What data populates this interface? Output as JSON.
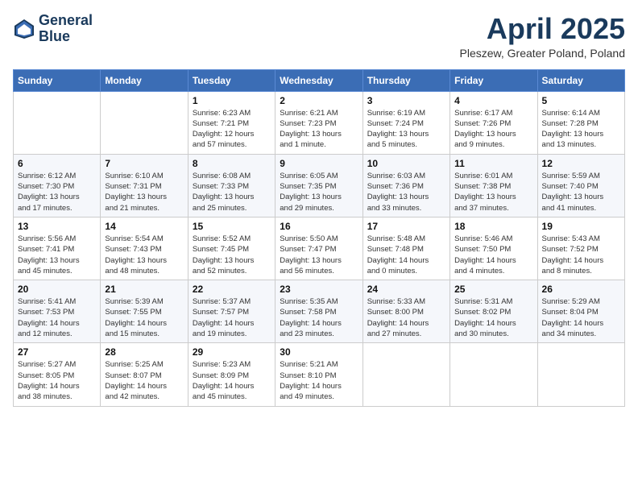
{
  "header": {
    "logo_line1": "General",
    "logo_line2": "Blue",
    "month_title": "April 2025",
    "location": "Pleszew, Greater Poland, Poland"
  },
  "weekdays": [
    "Sunday",
    "Monday",
    "Tuesday",
    "Wednesday",
    "Thursday",
    "Friday",
    "Saturday"
  ],
  "weeks": [
    [
      {
        "day": "",
        "info": ""
      },
      {
        "day": "",
        "info": ""
      },
      {
        "day": "1",
        "info": "Sunrise: 6:23 AM\nSunset: 7:21 PM\nDaylight: 12 hours\nand 57 minutes."
      },
      {
        "day": "2",
        "info": "Sunrise: 6:21 AM\nSunset: 7:23 PM\nDaylight: 13 hours\nand 1 minute."
      },
      {
        "day": "3",
        "info": "Sunrise: 6:19 AM\nSunset: 7:24 PM\nDaylight: 13 hours\nand 5 minutes."
      },
      {
        "day": "4",
        "info": "Sunrise: 6:17 AM\nSunset: 7:26 PM\nDaylight: 13 hours\nand 9 minutes."
      },
      {
        "day": "5",
        "info": "Sunrise: 6:14 AM\nSunset: 7:28 PM\nDaylight: 13 hours\nand 13 minutes."
      }
    ],
    [
      {
        "day": "6",
        "info": "Sunrise: 6:12 AM\nSunset: 7:30 PM\nDaylight: 13 hours\nand 17 minutes."
      },
      {
        "day": "7",
        "info": "Sunrise: 6:10 AM\nSunset: 7:31 PM\nDaylight: 13 hours\nand 21 minutes."
      },
      {
        "day": "8",
        "info": "Sunrise: 6:08 AM\nSunset: 7:33 PM\nDaylight: 13 hours\nand 25 minutes."
      },
      {
        "day": "9",
        "info": "Sunrise: 6:05 AM\nSunset: 7:35 PM\nDaylight: 13 hours\nand 29 minutes."
      },
      {
        "day": "10",
        "info": "Sunrise: 6:03 AM\nSunset: 7:36 PM\nDaylight: 13 hours\nand 33 minutes."
      },
      {
        "day": "11",
        "info": "Sunrise: 6:01 AM\nSunset: 7:38 PM\nDaylight: 13 hours\nand 37 minutes."
      },
      {
        "day": "12",
        "info": "Sunrise: 5:59 AM\nSunset: 7:40 PM\nDaylight: 13 hours\nand 41 minutes."
      }
    ],
    [
      {
        "day": "13",
        "info": "Sunrise: 5:56 AM\nSunset: 7:41 PM\nDaylight: 13 hours\nand 45 minutes."
      },
      {
        "day": "14",
        "info": "Sunrise: 5:54 AM\nSunset: 7:43 PM\nDaylight: 13 hours\nand 48 minutes."
      },
      {
        "day": "15",
        "info": "Sunrise: 5:52 AM\nSunset: 7:45 PM\nDaylight: 13 hours\nand 52 minutes."
      },
      {
        "day": "16",
        "info": "Sunrise: 5:50 AM\nSunset: 7:47 PM\nDaylight: 13 hours\nand 56 minutes."
      },
      {
        "day": "17",
        "info": "Sunrise: 5:48 AM\nSunset: 7:48 PM\nDaylight: 14 hours\nand 0 minutes."
      },
      {
        "day": "18",
        "info": "Sunrise: 5:46 AM\nSunset: 7:50 PM\nDaylight: 14 hours\nand 4 minutes."
      },
      {
        "day": "19",
        "info": "Sunrise: 5:43 AM\nSunset: 7:52 PM\nDaylight: 14 hours\nand 8 minutes."
      }
    ],
    [
      {
        "day": "20",
        "info": "Sunrise: 5:41 AM\nSunset: 7:53 PM\nDaylight: 14 hours\nand 12 minutes."
      },
      {
        "day": "21",
        "info": "Sunrise: 5:39 AM\nSunset: 7:55 PM\nDaylight: 14 hours\nand 15 minutes."
      },
      {
        "day": "22",
        "info": "Sunrise: 5:37 AM\nSunset: 7:57 PM\nDaylight: 14 hours\nand 19 minutes."
      },
      {
        "day": "23",
        "info": "Sunrise: 5:35 AM\nSunset: 7:58 PM\nDaylight: 14 hours\nand 23 minutes."
      },
      {
        "day": "24",
        "info": "Sunrise: 5:33 AM\nSunset: 8:00 PM\nDaylight: 14 hours\nand 27 minutes."
      },
      {
        "day": "25",
        "info": "Sunrise: 5:31 AM\nSunset: 8:02 PM\nDaylight: 14 hours\nand 30 minutes."
      },
      {
        "day": "26",
        "info": "Sunrise: 5:29 AM\nSunset: 8:04 PM\nDaylight: 14 hours\nand 34 minutes."
      }
    ],
    [
      {
        "day": "27",
        "info": "Sunrise: 5:27 AM\nSunset: 8:05 PM\nDaylight: 14 hours\nand 38 minutes."
      },
      {
        "day": "28",
        "info": "Sunrise: 5:25 AM\nSunset: 8:07 PM\nDaylight: 14 hours\nand 42 minutes."
      },
      {
        "day": "29",
        "info": "Sunrise: 5:23 AM\nSunset: 8:09 PM\nDaylight: 14 hours\nand 45 minutes."
      },
      {
        "day": "30",
        "info": "Sunrise: 5:21 AM\nSunset: 8:10 PM\nDaylight: 14 hours\nand 49 minutes."
      },
      {
        "day": "",
        "info": ""
      },
      {
        "day": "",
        "info": ""
      },
      {
        "day": "",
        "info": ""
      }
    ]
  ]
}
